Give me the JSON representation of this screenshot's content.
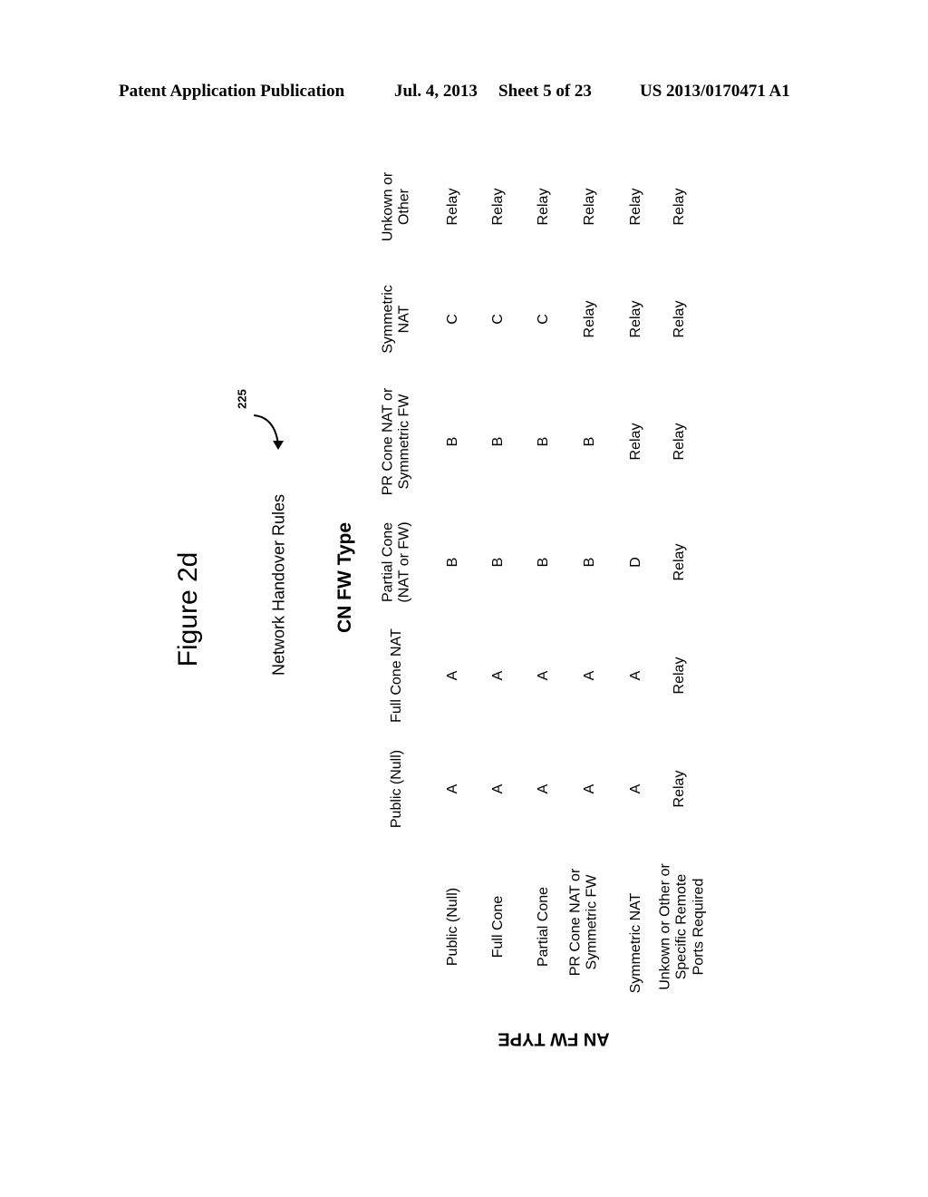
{
  "header": {
    "publication": "Patent Application Publication",
    "date": "Jul. 4, 2013",
    "sheet": "Sheet 5 of 23",
    "number": "US 2013/0170471 A1"
  },
  "figure": {
    "title": "Figure 2d",
    "subtitle": "Network Handover Rules",
    "reference": "225",
    "column_group_label": "CN FW Type",
    "row_group_label": "AN FW TYPE"
  },
  "table": {
    "columns": [
      [
        "Public (Null)"
      ],
      [
        "Full Cone NAT"
      ],
      [
        "Partial Cone",
        "(NAT or FW)"
      ],
      [
        "PR Cone NAT or",
        "Symmetric FW"
      ],
      [
        "Symmetric",
        "NAT"
      ],
      [
        "Unkown or",
        "Other"
      ]
    ],
    "rows": [
      {
        "label": [
          "Public (Null)"
        ],
        "cells": [
          "A",
          "A",
          "B",
          "B",
          "C",
          "Relay"
        ]
      },
      {
        "label": [
          "Full Cone"
        ],
        "cells": [
          "A",
          "A",
          "B",
          "B",
          "C",
          "Relay"
        ]
      },
      {
        "label": [
          "Partial Cone"
        ],
        "cells": [
          "A",
          "A",
          "B",
          "B",
          "C",
          "Relay"
        ]
      },
      {
        "label": [
          "PR Cone NAT or",
          "Symmetric FW"
        ],
        "cells": [
          "A",
          "A",
          "B",
          "B",
          "Relay",
          "Relay"
        ]
      },
      {
        "label": [
          "Symmetric NAT"
        ],
        "cells": [
          "A",
          "A",
          "D",
          "Relay",
          "Relay",
          "Relay"
        ]
      },
      {
        "label": [
          "Unkown or Other or",
          "Specific Remote",
          "Ports Required"
        ],
        "cells": [
          "Relay",
          "Relay",
          "Relay",
          "Relay",
          "Relay",
          "Relay"
        ]
      }
    ]
  }
}
